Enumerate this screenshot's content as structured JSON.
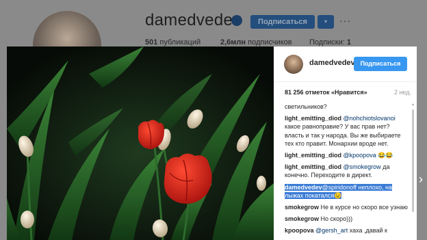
{
  "profile": {
    "username": "damedvedev",
    "follow_label": "Подписаться",
    "dropdown_icon": "▾",
    "more_icon": "···",
    "stats": {
      "posts_count": "501",
      "posts_label": "публикаций",
      "followers_count": "2,6млн",
      "followers_label": "подписчиков",
      "following_label": "Подписки:",
      "following_count": "1"
    }
  },
  "post": {
    "author": "damedvedev",
    "follow_label": "Подписаться",
    "likes_text": "81 256 отметок «Нравится»",
    "time_ago": "2 нед."
  },
  "comments": [
    {
      "author": "",
      "mention": "",
      "text": "светильников?"
    },
    {
      "author": "light_emitting_diod",
      "mention": "@nohchiotslovanoi",
      "text": "какое равноправие? У вас прав нет? власть и так у народа. Вы же выбираете тех кто правит. Монархии вроде нет."
    },
    {
      "author": "light_emitting_diod",
      "mention": "@kpoopova",
      "text": "😂😂"
    },
    {
      "author": "light_emitting_diod",
      "mention": "@smokegrow",
      "text": "да конечно. Переходите в директ."
    },
    {
      "author": "damedvedev",
      "mention": "@spiridonoff",
      "text": "неплохо, на лыжах покатался😉",
      "highlighted": true
    },
    {
      "author": "smokegrow",
      "mention": "",
      "text": "Не в курсе но скоро все узнаю"
    },
    {
      "author": "smokegrow",
      "mention": "",
      "text": "Но скоро)))"
    },
    {
      "author": "kpoopova",
      "mention": "@gersh_art",
      "text": "хаха ,давай к"
    }
  ],
  "colors": {
    "follow_button": "#3897f0",
    "highlight": "#3a7bd5",
    "mention": "#003569",
    "tulip_red": "#d0201a",
    "tulip_bud": "#e9ddc6",
    "leaf_green": "#1c5a1e"
  },
  "icons": {
    "verified": "verified-badge-icon",
    "next": "chevron-right-icon",
    "scroll_up": "scroll-up-arrow-icon"
  },
  "nav": {
    "next_arrow": "›",
    "scroll_up_glyph": "▲"
  }
}
